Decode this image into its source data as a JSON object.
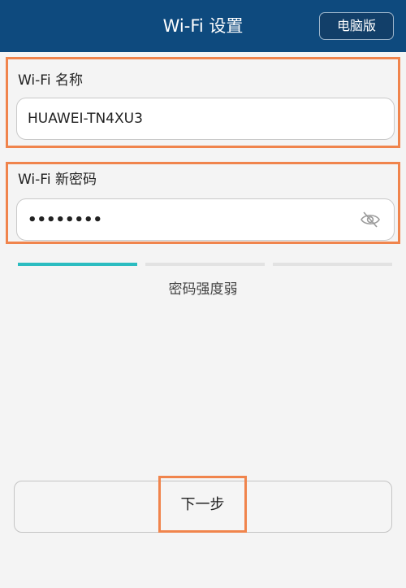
{
  "header": {
    "title": "Wi-Fi 设置",
    "desktop_label": "电脑版"
  },
  "wifi_name": {
    "label": "Wi-Fi 名称",
    "value": "HUAWEI-TN4XU3"
  },
  "wifi_password": {
    "label": "Wi-Fi 新密码",
    "masked_value": "••••••••",
    "toggle_icon": "eye-slash-icon"
  },
  "strength": {
    "text": "密码强度弱",
    "level": 1,
    "levels_total": 3,
    "active_color": "#2bbcc0"
  },
  "next_button": {
    "label": "下一步"
  },
  "colors": {
    "header_bg": "#0e4a7e",
    "highlight": "#f0844c"
  }
}
